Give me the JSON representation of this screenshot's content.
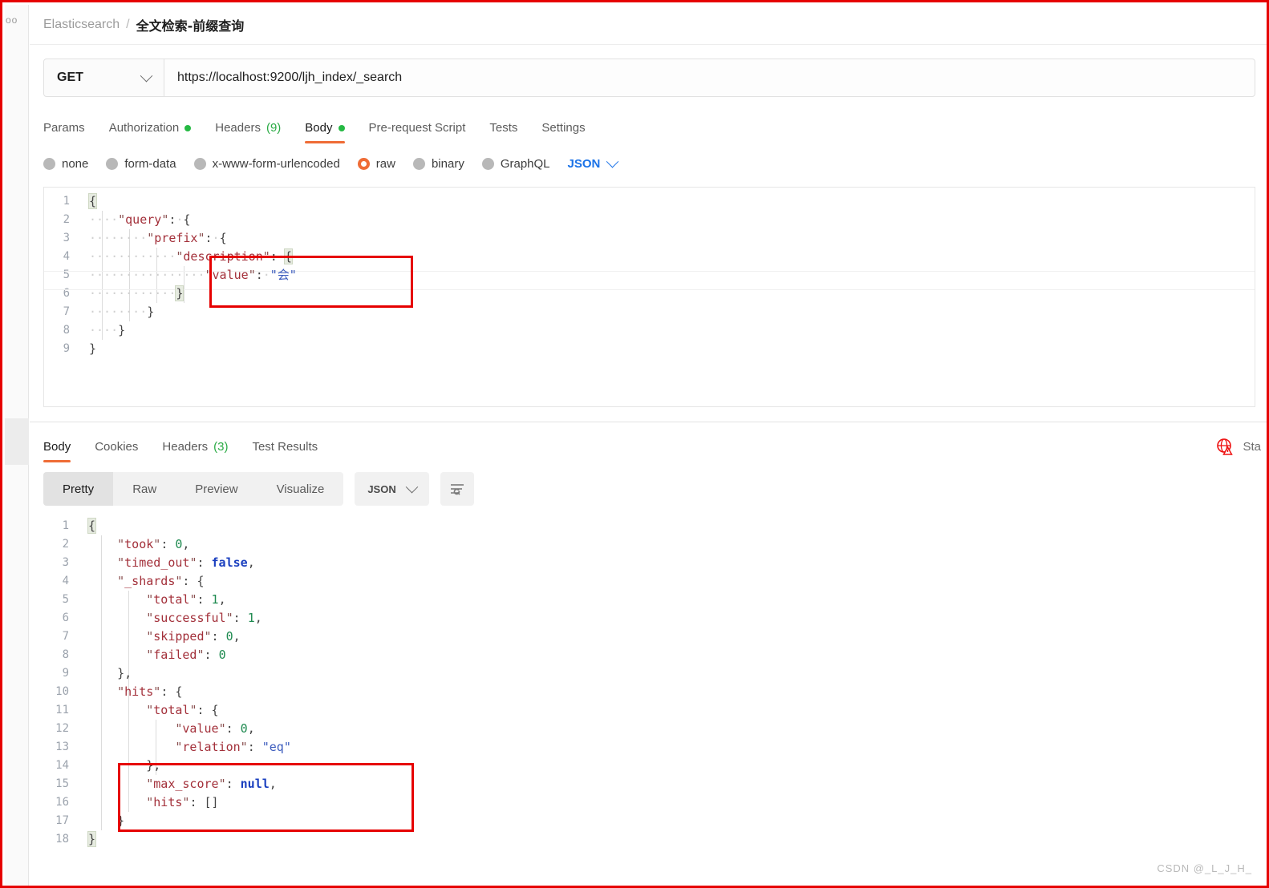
{
  "window": {
    "watermark": "CSDN @_L_J_H_",
    "left_rail_ghost": "oo"
  },
  "breadcrumb": {
    "root": "Elasticsearch",
    "separator": "/",
    "current": "全文检索-前缀查询"
  },
  "request": {
    "method": "GET",
    "url": "https://localhost:9200/ljh_index/_search",
    "tabs": [
      {
        "label": "Params",
        "active": false,
        "dot": false,
        "count": ""
      },
      {
        "label": "Authorization",
        "active": false,
        "dot": true,
        "count": ""
      },
      {
        "label": "Headers",
        "active": false,
        "dot": false,
        "count": "(9)"
      },
      {
        "label": "Body",
        "active": true,
        "dot": true,
        "count": ""
      },
      {
        "label": "Pre-request Script",
        "active": false,
        "dot": false,
        "count": ""
      },
      {
        "label": "Tests",
        "active": false,
        "dot": false,
        "count": ""
      },
      {
        "label": "Settings",
        "active": false,
        "dot": false,
        "count": ""
      }
    ],
    "body_types": [
      {
        "label": "none",
        "selected": false
      },
      {
        "label": "form-data",
        "selected": false
      },
      {
        "label": "x-www-form-urlencoded",
        "selected": false
      },
      {
        "label": "raw",
        "selected": true
      },
      {
        "label": "binary",
        "selected": false
      },
      {
        "label": "GraphQL",
        "selected": false
      }
    ],
    "raw_format": "JSON",
    "body_lines": [
      "{",
      "    \"query\": {",
      "        \"prefix\": {",
      "            \"description\": {",
      "                \"value\": \"会\"",
      "            }",
      "        }",
      "    }",
      "}"
    ],
    "body_json": {
      "query": {
        "prefix": {
          "description": {
            "value": "会"
          }
        }
      }
    }
  },
  "response": {
    "tabs": [
      {
        "label": "Body",
        "active": true,
        "count": ""
      },
      {
        "label": "Cookies",
        "active": false,
        "count": ""
      },
      {
        "label": "Headers",
        "active": false,
        "count": "(3)"
      },
      {
        "label": "Test Results",
        "active": false,
        "count": ""
      }
    ],
    "status_text": "Sta",
    "view_modes": [
      {
        "label": "Pretty",
        "active": true
      },
      {
        "label": "Raw",
        "active": false
      },
      {
        "label": "Preview",
        "active": false
      },
      {
        "label": "Visualize",
        "active": false
      }
    ],
    "format": "JSON",
    "body_lines": [
      "{",
      "    \"took\": 0,",
      "    \"timed_out\": false,",
      "    \"_shards\": {",
      "        \"total\": 1,",
      "        \"successful\": 1,",
      "        \"skipped\": 0,",
      "        \"failed\": 0",
      "    },",
      "    \"hits\": {",
      "        \"total\": {",
      "            \"value\": 0,",
      "            \"relation\": \"eq\"",
      "        },",
      "        \"max_score\": null,",
      "        \"hits\": []",
      "    }",
      "}"
    ],
    "body_json": {
      "took": 0,
      "timed_out": false,
      "_shards": {
        "total": 1,
        "successful": 1,
        "skipped": 0,
        "failed": 0
      },
      "hits": {
        "total": {
          "value": 0,
          "relation": "eq"
        },
        "max_score": null,
        "hits": []
      }
    }
  },
  "colors": {
    "accent": "#ef6c36",
    "annotation": "#e60000",
    "link": "#1b73e8",
    "ok_dot": "#25b943"
  }
}
